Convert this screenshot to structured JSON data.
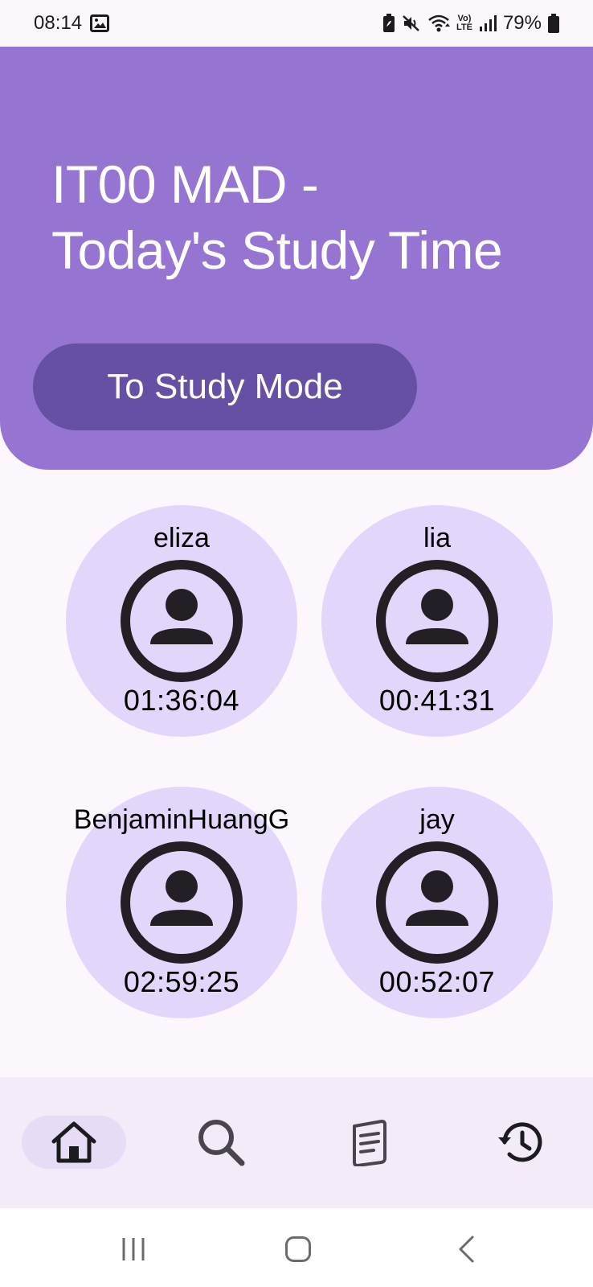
{
  "status_bar": {
    "time": "08:14",
    "battery": "79%",
    "icons": [
      "image-icon",
      "battery-saver-icon",
      "mute-icon",
      "wifi-icon",
      "volte-icon",
      "signal-icon",
      "battery-icon"
    ],
    "volte_line1": "Vo)",
    "volte_line2": "LTE"
  },
  "header": {
    "title_line1": "IT00 MAD -",
    "title_line2": "Today's Study Time",
    "button_label": "To Study Mode",
    "colors": {
      "background": "#9675D2",
      "button": "#6650A3",
      "text": "#FFFFFF"
    }
  },
  "users": [
    {
      "name": "eliza",
      "time": "01:36:04",
      "icon": "account-circle-icon"
    },
    {
      "name": "lia",
      "time": "00:41:31",
      "icon": "account-circle-icon"
    },
    {
      "name": "BenjaminHuangG",
      "time": "02:59:25",
      "icon": "account-circle-icon"
    },
    {
      "name": "jay",
      "time": "00:52:07",
      "icon": "account-circle-icon"
    }
  ],
  "user_card_color": "#E3D6FB",
  "bottom_nav": {
    "items": [
      {
        "icon": "home-icon",
        "active": true
      },
      {
        "icon": "search-icon",
        "active": false
      },
      {
        "icon": "notes-icon",
        "active": false
      },
      {
        "icon": "history-icon",
        "active": false
      }
    ]
  },
  "system_nav": {
    "items": [
      "recents-icon",
      "home-button-icon",
      "back-icon"
    ]
  }
}
